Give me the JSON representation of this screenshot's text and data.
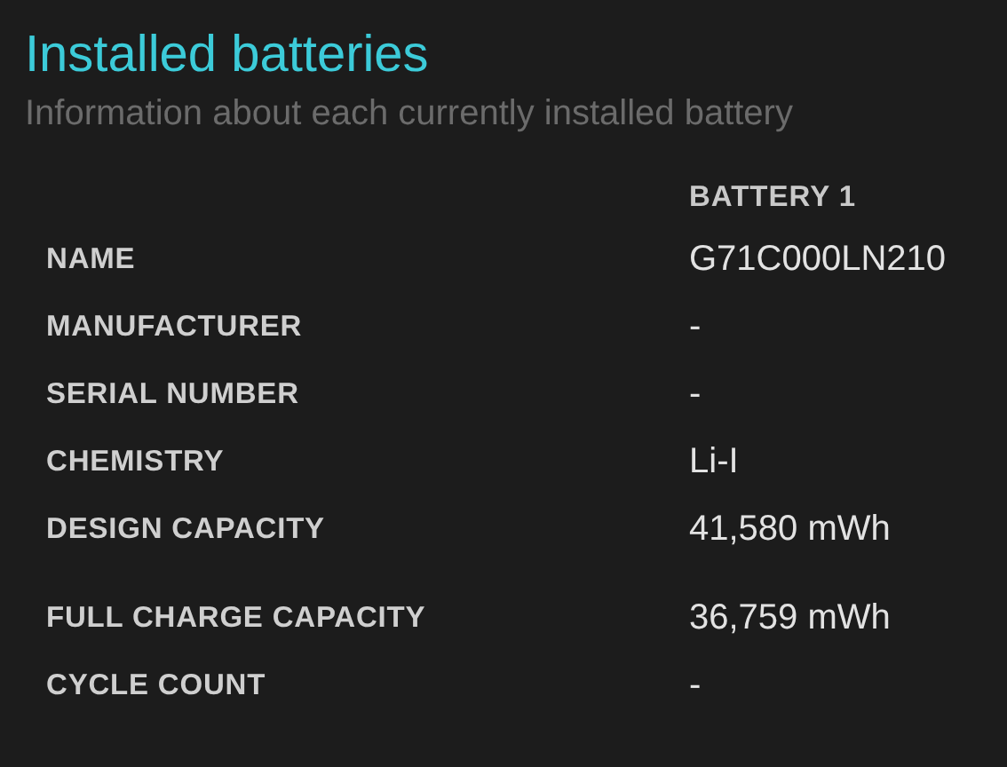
{
  "title": "Installed batteries",
  "subtitle": "Information about each currently installed battery",
  "table": {
    "columns": [
      "BATTERY 1"
    ],
    "groups": [
      [
        {
          "label": "NAME",
          "value": "G71C000LN210"
        },
        {
          "label": "MANUFACTURER",
          "value": "-"
        },
        {
          "label": "SERIAL NUMBER",
          "value": "-"
        },
        {
          "label": "CHEMISTRY",
          "value": "Li-I"
        },
        {
          "label": "DESIGN CAPACITY",
          "value": "41,580 mWh"
        }
      ],
      [
        {
          "label": "FULL CHARGE CAPACITY",
          "value": "36,759 mWh"
        },
        {
          "label": "CYCLE COUNT",
          "value": "-"
        }
      ]
    ]
  }
}
